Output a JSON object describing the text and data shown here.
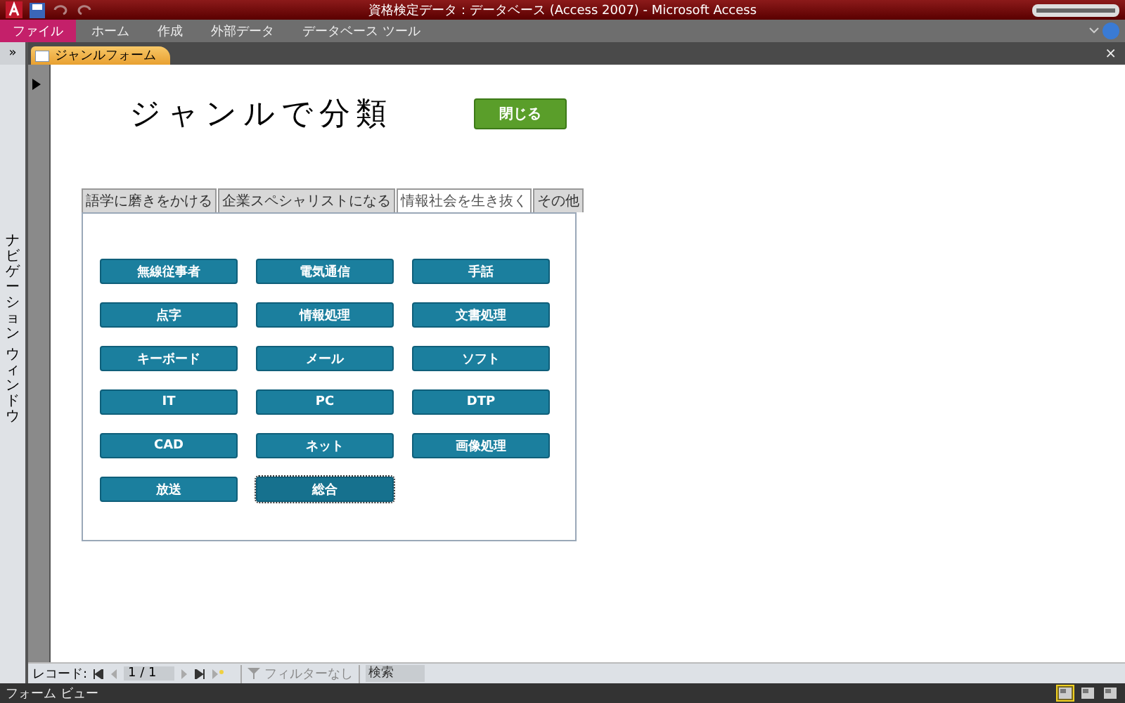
{
  "window": {
    "title": "資格検定データ：データベース (Access 2007) - Microsoft Access"
  },
  "ribbon_tabs": [
    {
      "label": "ファイル",
      "selected": true
    },
    {
      "label": "ホーム",
      "selected": false
    },
    {
      "label": "作成",
      "selected": false
    },
    {
      "label": "外部データ",
      "selected": false
    },
    {
      "label": "データベース ツール",
      "selected": false
    }
  ],
  "nav_pane": {
    "toggle": "»",
    "label": [
      "ナビゲーション",
      "ウィンドウ"
    ]
  },
  "document_tab": {
    "label": "ジャンルフォーム",
    "close": "×"
  },
  "form": {
    "heading": "ジャンルで分類",
    "close_button": "閉じる",
    "tabs": [
      {
        "label": "語学に磨きをかける",
        "selected": false
      },
      {
        "label": "企業スペシャリストになる",
        "selected": false
      },
      {
        "label": "情報社会を生き抜く",
        "selected": true
      },
      {
        "label": "その他",
        "selected": false
      }
    ],
    "buttons": [
      {
        "label": "無線従事者",
        "focused": false
      },
      {
        "label": "電気通信",
        "focused": false
      },
      {
        "label": "手話",
        "focused": false
      },
      {
        "label": "点字",
        "focused": false
      },
      {
        "label": "情報処理",
        "focused": false
      },
      {
        "label": "文書処理",
        "focused": false
      },
      {
        "label": "キーボード",
        "focused": false
      },
      {
        "label": "メール",
        "focused": false
      },
      {
        "label": "ソフト",
        "focused": false
      },
      {
        "label": "IT",
        "focused": false
      },
      {
        "label": "PC",
        "focused": false
      },
      {
        "label": "DTP",
        "focused": false
      },
      {
        "label": "CAD",
        "focused": false
      },
      {
        "label": "ネット",
        "focused": false
      },
      {
        "label": "画像処理",
        "focused": false
      },
      {
        "label": "放送",
        "focused": false
      },
      {
        "label": "総合",
        "focused": true
      }
    ]
  },
  "record_nav": {
    "label": "レコード:",
    "position": "1 / 1",
    "filter": "フィルターなし",
    "search": {
      "placeholder": "検索"
    }
  },
  "status_bar": {
    "text": "フォーム ビュー",
    "views": [
      {
        "selected": true
      },
      {
        "selected": false
      },
      {
        "selected": false
      }
    ]
  }
}
